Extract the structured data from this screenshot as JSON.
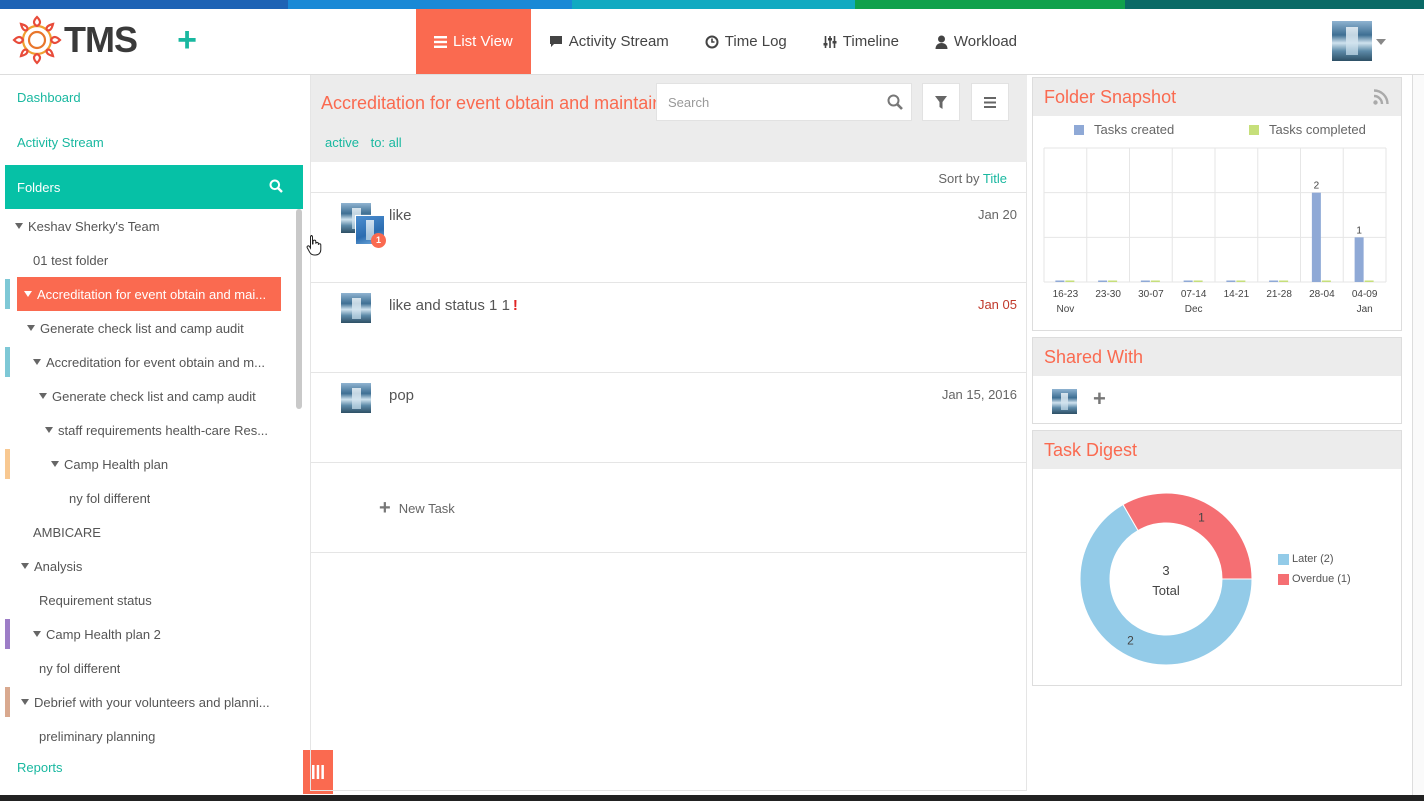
{
  "app": {
    "logo_text": "TMS"
  },
  "colors": {
    "accent": "#fa6a50",
    "teal": "#06c1a6",
    "link": "#19b8a0",
    "tasks_created": "#8fa9d6",
    "tasks_completed": "#c6df7a",
    "later": "#93cbe8",
    "overdue": "#f56f73"
  },
  "nav": [
    {
      "label": "List View",
      "icon": "list-icon"
    },
    {
      "label": "Activity Stream",
      "icon": "comment-icon"
    },
    {
      "label": "Time Log",
      "icon": "clock-icon"
    },
    {
      "label": "Timeline",
      "icon": "sliders-icon"
    },
    {
      "label": "Workload",
      "icon": "user-icon"
    }
  ],
  "sidebar": {
    "dashboard": "Dashboard",
    "activity_stream": "Activity Stream",
    "folders": "Folders",
    "reports": "Reports",
    "tree": [
      {
        "label": "Keshav Sherky's Team",
        "caret": true
      },
      {
        "label": "01 test folder",
        "caret": false
      },
      {
        "label": "Accreditation for event obtain and mai...",
        "caret": true,
        "selected": true,
        "mark": "#7ec8d6"
      },
      {
        "label": "Generate check list and camp audit",
        "caret": true
      },
      {
        "label": "Accreditation for event obtain and m...",
        "caret": true,
        "mark": "#7ec8d6"
      },
      {
        "label": "Generate check list and camp audit",
        "caret": true
      },
      {
        "label": "staff requirements health-care Res...",
        "caret": true
      },
      {
        "label": "Camp Health plan",
        "caret": true,
        "mark": "#f8c891"
      },
      {
        "label": "ny fol different",
        "caret": false
      },
      {
        "label": "AMBICARE",
        "caret": false
      },
      {
        "label": "Analysis",
        "caret": true
      },
      {
        "label": "Requirement status",
        "caret": false
      },
      {
        "label": "Camp Health plan 2",
        "caret": true,
        "mark": "#9d7dc7"
      },
      {
        "label": "ny fol different",
        "caret": false
      },
      {
        "label": "Debrief with your volunteers and planni...",
        "caret": true,
        "mark": "#d9a98f"
      },
      {
        "label": "preliminary planning",
        "caret": false
      }
    ]
  },
  "main": {
    "folder_title": "Accreditation for event obtain and maintain",
    "search_placeholder": "Search",
    "filter_active": "active",
    "filter_to": "to: all",
    "sort_label": "Sort by",
    "sort_value": "Title",
    "tasks": [
      {
        "title": "like",
        "date": "Jan 20",
        "badge": "1",
        "overdue": false,
        "important": false
      },
      {
        "title": "like and status 1 1",
        "date": "Jan 05",
        "overdue": true,
        "important": true,
        "important_mark": "!"
      },
      {
        "title": "pop",
        "date": "Jan 15, 2016",
        "overdue": false,
        "important": false
      }
    ],
    "new_task": "New Task"
  },
  "snapshot": {
    "title": "Folder Snapshot",
    "legend_created": "Tasks created",
    "legend_completed": "Tasks completed"
  },
  "shared": {
    "title": "Shared With"
  },
  "digest": {
    "title": "Task Digest",
    "total_value": "3",
    "total_label": "Total",
    "legend_later": "Later (2)",
    "legend_overdue": "Overdue (1)"
  },
  "chart_data": [
    {
      "type": "bar",
      "title": "Folder Snapshot",
      "categories": [
        "16-23",
        "23-30",
        "30-07",
        "07-14",
        "14-21",
        "21-28",
        "28-04",
        "04-09"
      ],
      "month_labels": [
        "Nov",
        "",
        "",
        "Dec",
        "",
        "",
        "",
        "Jan"
      ],
      "series": [
        {
          "name": "Tasks created",
          "values": [
            0,
            0,
            0,
            0,
            0,
            0,
            2,
            1
          ]
        },
        {
          "name": "Tasks completed",
          "values": [
            0,
            0,
            0,
            0,
            0,
            0,
            0,
            0
          ]
        }
      ],
      "grid": true,
      "legend": "top"
    },
    {
      "type": "pie",
      "title": "Task Digest",
      "categories": [
        "Later (2)",
        "Overdue (1)"
      ],
      "values": [
        2,
        1
      ],
      "donut": true,
      "center_text": "3 Total",
      "legend": "right"
    }
  ]
}
